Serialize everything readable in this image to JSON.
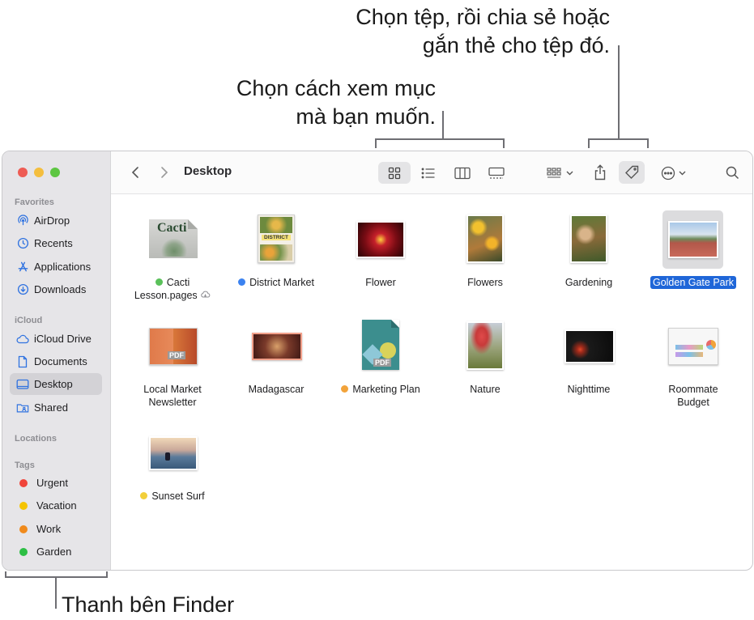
{
  "callouts": {
    "share_line1": "Chọn tệp, rồi chia sẻ hoặc",
    "share_line2": "gắn thẻ cho tệp đó.",
    "view_line1": "Chọn cách xem mục",
    "view_line2": "mà bạn muốn.",
    "sidebar": "Thanh bên Finder"
  },
  "window": {
    "title": "Desktop"
  },
  "sidebar": {
    "favorites_header": "Favorites",
    "favorites": [
      {
        "label": "AirDrop",
        "icon": "airdrop-icon"
      },
      {
        "label": "Recents",
        "icon": "clock-icon"
      },
      {
        "label": "Applications",
        "icon": "applications-icon"
      },
      {
        "label": "Downloads",
        "icon": "download-icon"
      }
    ],
    "icloud_header": "iCloud",
    "icloud": [
      {
        "label": "iCloud Drive",
        "icon": "cloud-icon"
      },
      {
        "label": "Documents",
        "icon": "document-icon"
      },
      {
        "label": "Desktop",
        "icon": "desktop-icon"
      },
      {
        "label": "Shared",
        "icon": "shared-folder-icon"
      }
    ],
    "locations_header": "Locations",
    "tags_header": "Tags",
    "tags": [
      {
        "label": "Urgent",
        "color": "#f0443a"
      },
      {
        "label": "Vacation",
        "color": "#f5c400"
      },
      {
        "label": "Work",
        "color": "#f08a1c"
      },
      {
        "label": "Garden",
        "color": "#2dbf44"
      }
    ]
  },
  "files": [
    {
      "name": "Cacti Lesson.pages",
      "line1": "Cacti",
      "line2": "Lesson.pages",
      "tag": "#5ac15a"
    },
    {
      "name": "District Market",
      "tag": "#3b82f0"
    },
    {
      "name": "Flower"
    },
    {
      "name": "Flowers"
    },
    {
      "name": "Gardening"
    },
    {
      "name": "Golden Gate Park",
      "selected": true
    },
    {
      "name": "Local Market Newsletter",
      "line1": "Local Market",
      "line2": "Newsletter"
    },
    {
      "name": "Madagascar"
    },
    {
      "name": "Marketing Plan",
      "tag": "#f2a33a"
    },
    {
      "name": "Nature"
    },
    {
      "name": "Nighttime"
    },
    {
      "name": "Roommate Budget",
      "line1": "Roommate",
      "line2": "Budget"
    },
    {
      "name": "Sunset Surf",
      "tag": "#f2cf3a"
    }
  ],
  "thumb_text": {
    "cacti": "Cacti",
    "district": "DISTRICT",
    "pdf": "PDF"
  }
}
